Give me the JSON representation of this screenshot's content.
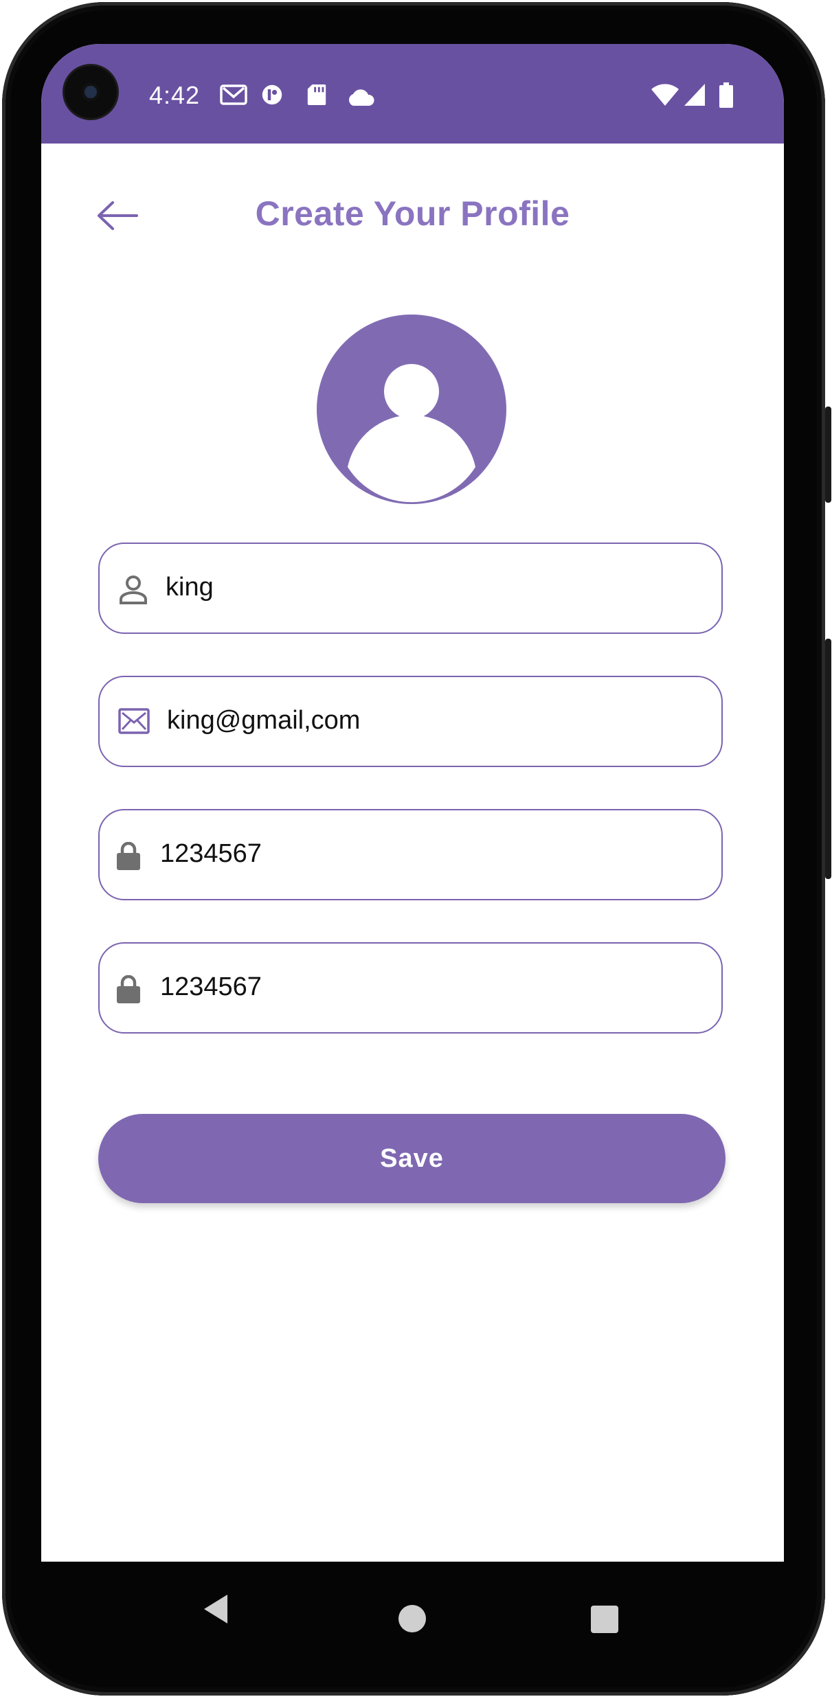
{
  "status_bar": {
    "time": "4:42",
    "left_icons": [
      "gmail-icon",
      "app-icon",
      "sd-card-icon",
      "cloud-icon"
    ],
    "right_icons": [
      "wifi-icon",
      "signal-icon",
      "battery-icon"
    ],
    "color": "#6951a1"
  },
  "header": {
    "title": "Create Your Profile",
    "back_icon": "arrow-left-icon"
  },
  "avatar": {
    "icon": "person-icon"
  },
  "form": {
    "name": {
      "icon": "person-outline-icon",
      "value": "king"
    },
    "email": {
      "icon": "mail-icon",
      "value": "king@gmail,com"
    },
    "password": {
      "icon": "lock-icon",
      "value": "1234567"
    },
    "confirm_password": {
      "icon": "lock-icon",
      "value": "1234567"
    }
  },
  "save_button": {
    "label": "Save"
  },
  "nav_bar": {
    "icons": [
      "nav-back-icon",
      "nav-home-icon",
      "nav-recents-icon"
    ]
  },
  "colors": {
    "accent": "#7f68b1",
    "title": "#8a74c0",
    "field_border": "#7b63b0"
  }
}
